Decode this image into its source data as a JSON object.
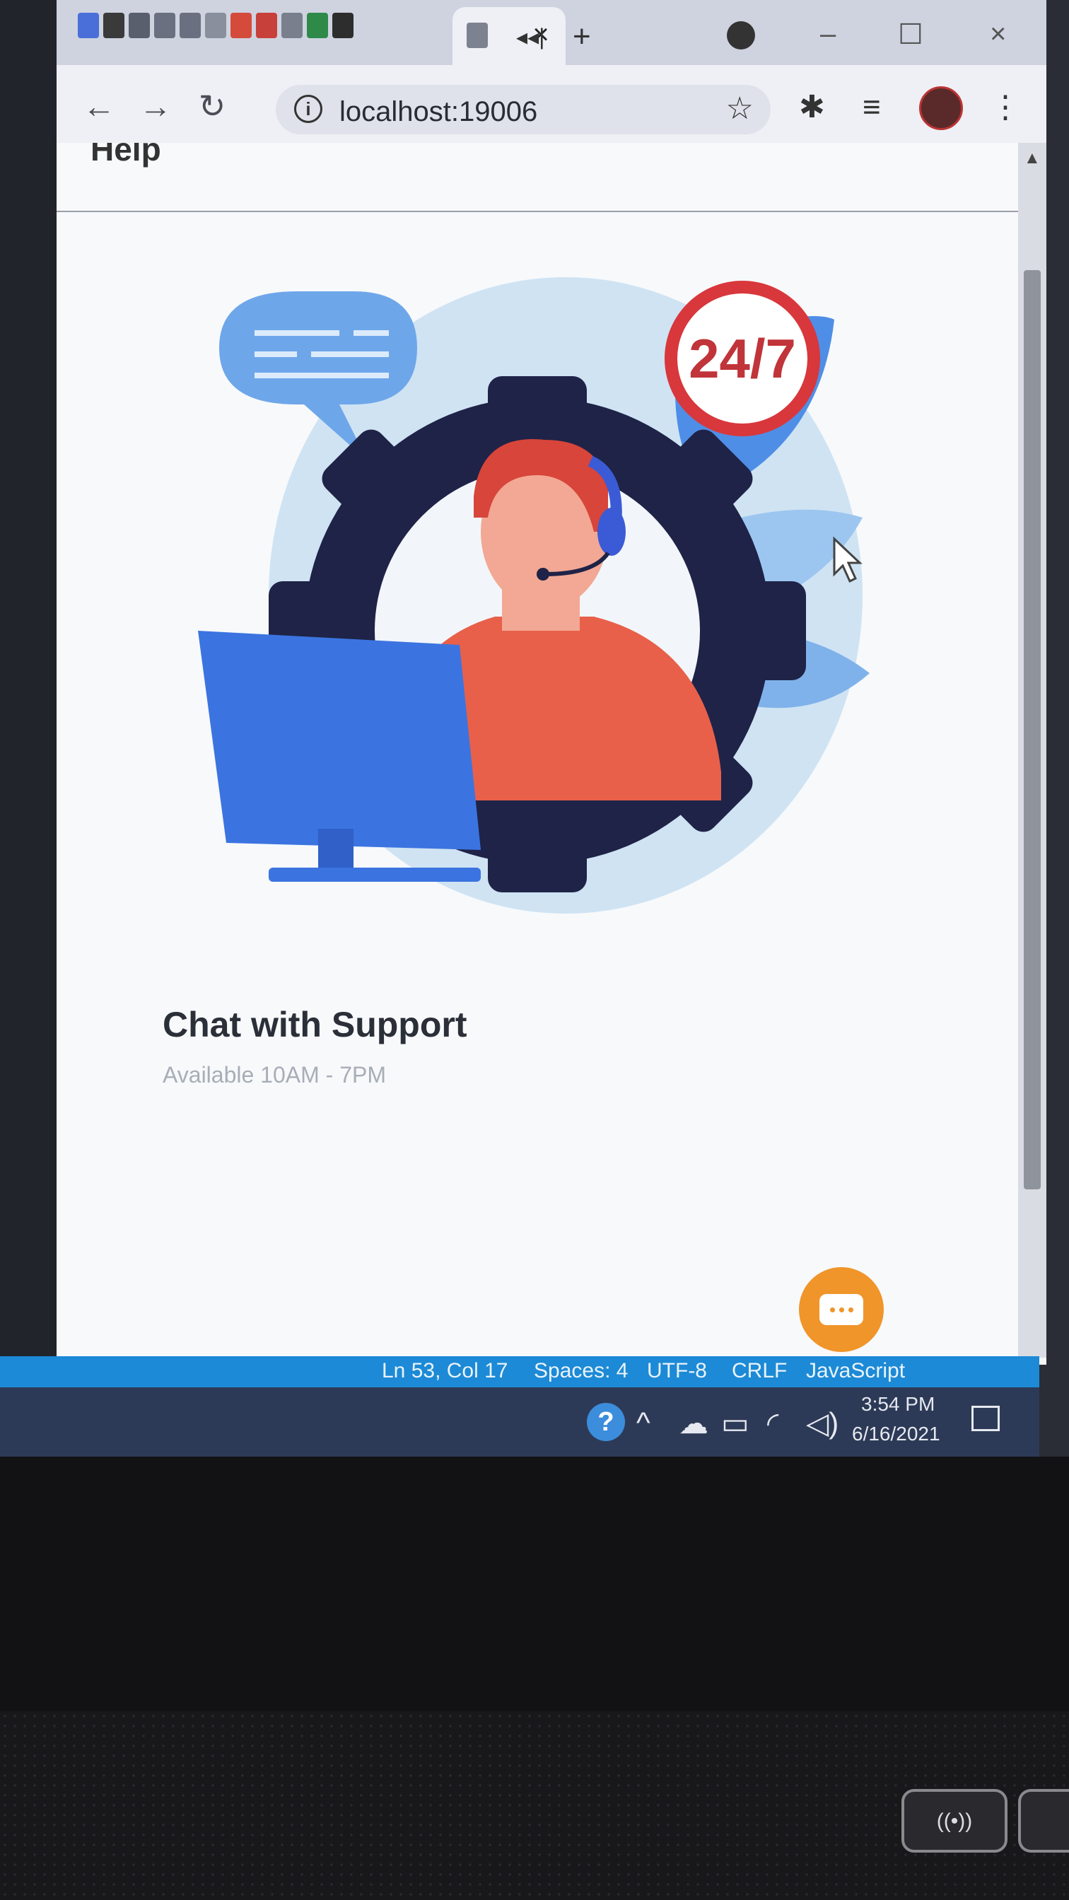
{
  "browser": {
    "url": "localhost:19006",
    "active_tab_close": "×",
    "new_tab": "+",
    "window_controls": {
      "minimize": "–",
      "maximize": "☐",
      "close": "×"
    }
  },
  "page": {
    "title": "Help",
    "illustration": {
      "badge_text": "24/7"
    },
    "headline": "Chat with Support",
    "subline": "Available 10AM - 7PM"
  },
  "vscode_status": {
    "position": "Ln 53, Col 17",
    "spaces": "Spaces: 4",
    "encoding": "UTF-8",
    "eol": "CRLF",
    "language": "JavaScript"
  },
  "taskbar": {
    "time": "3:54 PM",
    "date": "6/16/2021"
  },
  "colors": {
    "accent_orange": "#f0952a",
    "badge_red": "#d8373c",
    "gear_navy": "#1f2347",
    "monitor_blue": "#3b74e0",
    "shirt_red": "#e8604a",
    "status_blue": "#1c8ad6"
  },
  "icons": [
    "back-icon",
    "forward-icon",
    "reload-icon",
    "info-icon",
    "star-icon",
    "extensions-icon",
    "reading-list-icon",
    "profile-avatar",
    "menu-icon",
    "chat-icon",
    "help-icon",
    "chevron-up-icon",
    "cloud-icon",
    "battery-icon",
    "wifi-icon",
    "volume-icon",
    "notification-icon"
  ]
}
